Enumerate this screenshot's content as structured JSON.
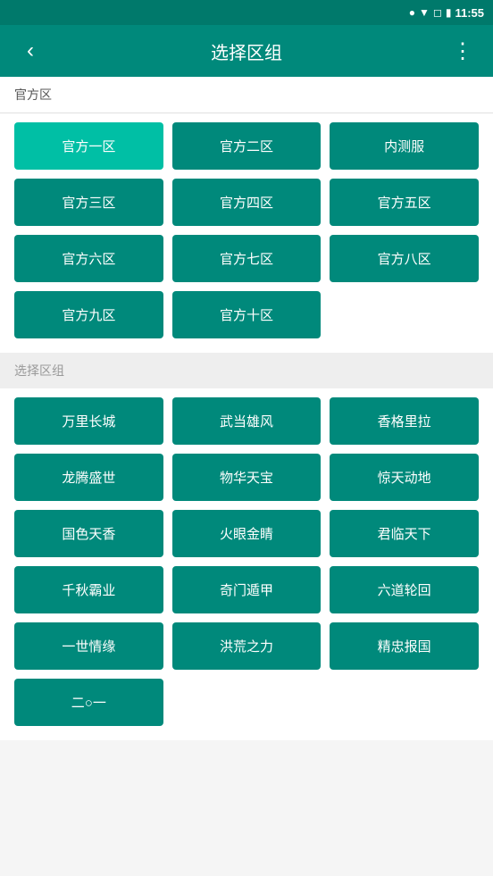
{
  "statusBar": {
    "time": "11:55",
    "icons": [
      "location",
      "wifi",
      "signal-off",
      "battery"
    ]
  },
  "appBar": {
    "backLabel": "‹",
    "title": "选择区组",
    "menuLabel": "⋮"
  },
  "sectionHeader": {
    "label": "官方区"
  },
  "officialServers": [
    {
      "id": "s1",
      "label": "官方一区"
    },
    {
      "id": "s2",
      "label": "官方二区"
    },
    {
      "id": "s3",
      "label": "内测服"
    },
    {
      "id": "s4",
      "label": "官方三区"
    },
    {
      "id": "s5",
      "label": "官方四区"
    },
    {
      "id": "s6",
      "label": "官方五区"
    },
    {
      "id": "s7",
      "label": "官方六区"
    },
    {
      "id": "s8",
      "label": "官方七区"
    },
    {
      "id": "s9",
      "label": "官方八区"
    },
    {
      "id": "s10",
      "label": "官方九区"
    },
    {
      "id": "s11",
      "label": "官方十区"
    }
  ],
  "divider": {
    "label": "选择区组"
  },
  "privateServers": [
    {
      "id": "p1",
      "label": "万里长城"
    },
    {
      "id": "p2",
      "label": "武当雄风"
    },
    {
      "id": "p3",
      "label": "香格里拉"
    },
    {
      "id": "p4",
      "label": "龙腾盛世"
    },
    {
      "id": "p5",
      "label": "物华天宝"
    },
    {
      "id": "p6",
      "label": "惊天动地"
    },
    {
      "id": "p7",
      "label": "国色天香"
    },
    {
      "id": "p8",
      "label": "火眼金睛"
    },
    {
      "id": "p9",
      "label": "君临天下"
    },
    {
      "id": "p10",
      "label": "千秋霸业"
    },
    {
      "id": "p11",
      "label": "奇门遁甲"
    },
    {
      "id": "p12",
      "label": "六道轮回"
    },
    {
      "id": "p13",
      "label": "一世情缘"
    },
    {
      "id": "p14",
      "label": "洪荒之力"
    },
    {
      "id": "p15",
      "label": "精忠报国"
    },
    {
      "id": "p16",
      "label": "二○一"
    }
  ]
}
